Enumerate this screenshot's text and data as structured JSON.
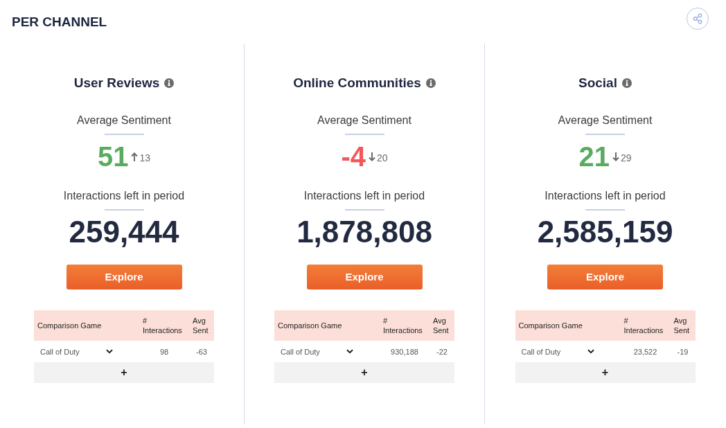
{
  "header": {
    "title": "PER CHANNEL"
  },
  "channels": [
    {
      "name": "User Reviews",
      "sentiment_label": "Average Sentiment",
      "sentiment": {
        "value": "51",
        "color": "#5aab5f",
        "rising": true,
        "change": "13"
      },
      "interactions_label": "Interactions left in period",
      "interactions": "259,444",
      "button": "Explore",
      "table": {
        "columns": [
          "Comparison Game",
          "# Interactions",
          "Avg Sent"
        ],
        "rows": [
          {
            "game": "Call of Duty",
            "interactions": "98",
            "avg_sent": "-63"
          }
        ],
        "add_button": "+"
      }
    },
    {
      "name": "Online Communities",
      "sentiment_label": "Average Sentiment",
      "sentiment": {
        "value": "-4",
        "color": "#f2585b",
        "rising": false,
        "change": "20"
      },
      "interactions_label": "Interactions left in period",
      "interactions": "1,878,808",
      "button": "Explore",
      "table": {
        "columns": [
          "Comparison Game",
          "# Interactions",
          "Avg Sent"
        ],
        "rows": [
          {
            "game": "Call of Duty",
            "interactions": "930,188",
            "avg_sent": "-22"
          }
        ],
        "add_button": "+"
      }
    },
    {
      "name": "Social",
      "sentiment_label": "Average Sentiment",
      "sentiment": {
        "value": "21",
        "color": "#5aab5f",
        "rising": false,
        "change": "29"
      },
      "interactions_label": "Interactions left in period",
      "interactions": "2,585,159",
      "button": "Explore",
      "table": {
        "columns": [
          "Comparison Game",
          "# Interactions",
          "Avg Sent"
        ],
        "rows": [
          {
            "game": "Call of Duty",
            "interactions": "23,522",
            "avg_sent": "-19"
          }
        ],
        "add_button": "+"
      }
    }
  ]
}
